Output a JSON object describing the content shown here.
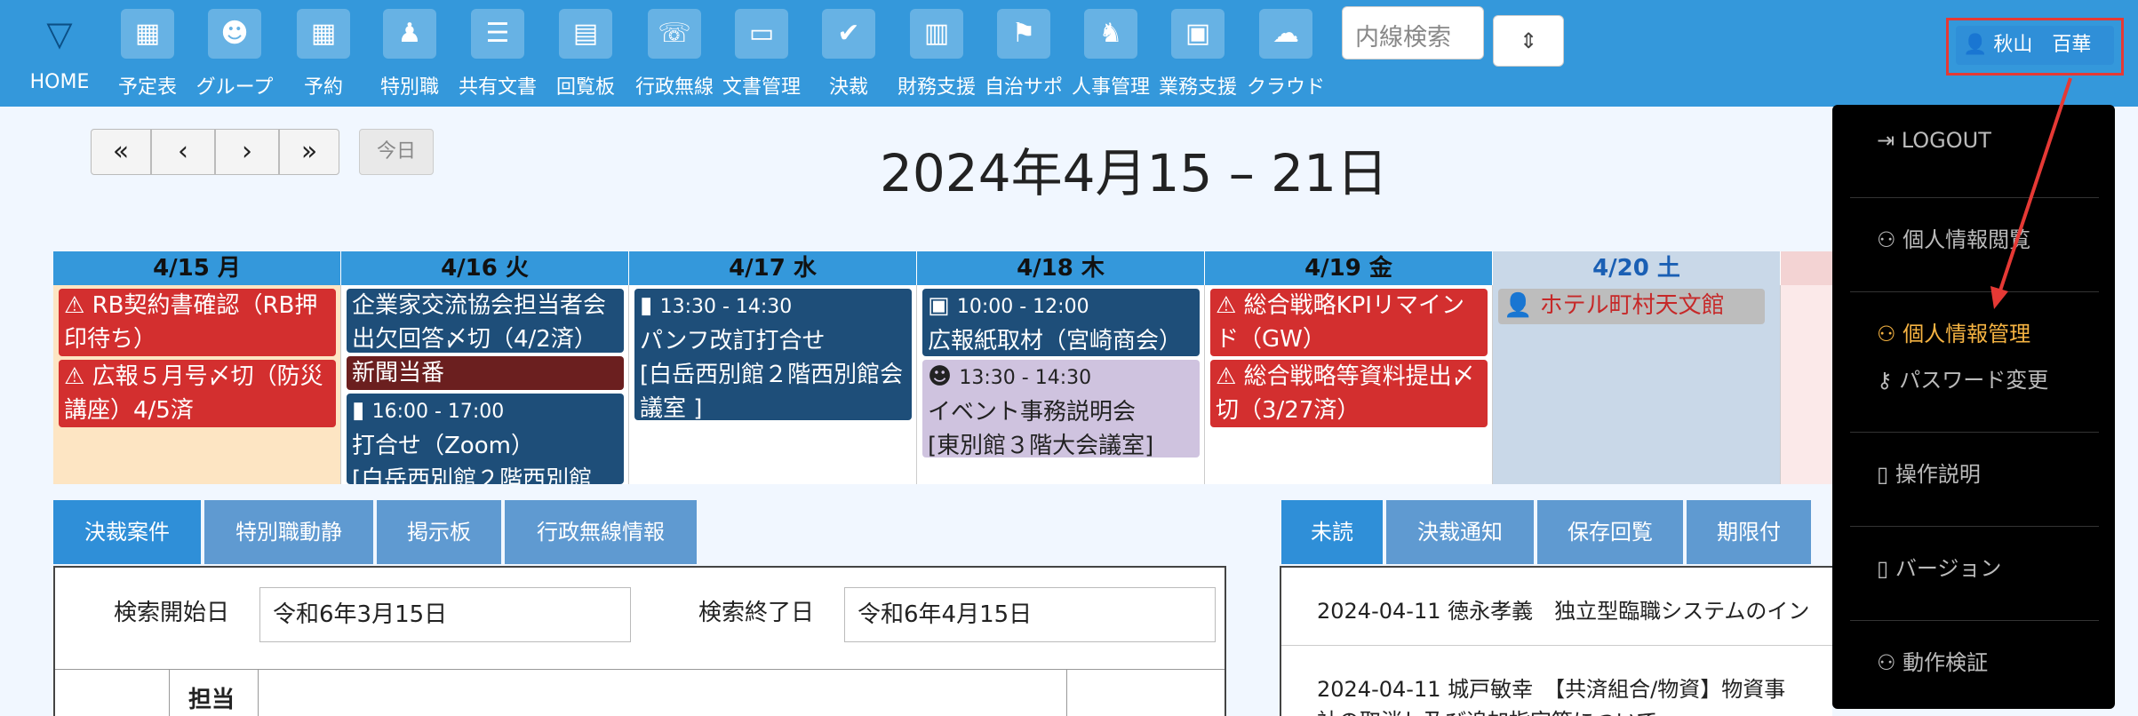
{
  "nav": [
    {
      "label": "HOME",
      "icon": "home-logo-icon"
    },
    {
      "label": "予定表",
      "icon": "calendar-icon"
    },
    {
      "label": "グループ",
      "icon": "group-icon"
    },
    {
      "label": "予約",
      "icon": "reservation-icon"
    },
    {
      "label": "特別職",
      "icon": "special-staff-icon"
    },
    {
      "label": "共有文書",
      "icon": "shared-docs-icon"
    },
    {
      "label": "回覧板",
      "icon": "clipboard-icon"
    },
    {
      "label": "行政無線",
      "icon": "radio-icon"
    },
    {
      "label": "文書管理",
      "icon": "document-icon"
    },
    {
      "label": "決裁",
      "icon": "approval-check-icon"
    },
    {
      "label": "財務支援",
      "icon": "finance-icon"
    },
    {
      "label": "自治サポ",
      "icon": "support-icon"
    },
    {
      "label": "人事管理",
      "icon": "hr-icon"
    },
    {
      "label": "業務支援",
      "icon": "business-icon"
    },
    {
      "label": "クラウド",
      "icon": "cloud-icon"
    }
  ],
  "search_placeholder": "内線検索",
  "user": {
    "name": "秋山　百華"
  },
  "calendar": {
    "title": "2024年4月15 – 21日",
    "today_label": "今日",
    "nav": [
      "«",
      "‹",
      "›",
      "»"
    ],
    "days": [
      {
        "label": "4/15 月"
      },
      {
        "label": "4/16 火"
      },
      {
        "label": "4/17 水"
      },
      {
        "label": "4/18 木"
      },
      {
        "label": "4/19 金"
      },
      {
        "label": "4/20 土"
      }
    ],
    "events": {
      "mon": [
        {
          "title": "RB契約書確認（RB押印待ち）"
        },
        {
          "title": "広報５月号〆切（防災講座）4/5済"
        }
      ],
      "tue": [
        {
          "title": "企業家交流協会担当者会出欠回答〆切（4/2済）"
        },
        {
          "title": "新聞当番"
        },
        {
          "time": "16:00 - 17:00",
          "title": "打合せ（Zoom）",
          "loc": "[白岳西別館２階西別館"
        }
      ],
      "wed": [
        {
          "time": "13:30 - 14:30",
          "title": "パンフ改訂打合せ",
          "loc": "[白岳西別館２階西別館会議室 ]"
        }
      ],
      "thu": [
        {
          "time": "10:00 - 12:00",
          "title": "広報紙取材（宮崎商会）"
        },
        {
          "time": "13:30 - 14:30",
          "title": "イベント事務説明会",
          "loc": "[東別館３階大会議室]"
        }
      ],
      "fri": [
        {
          "title": "総合戦略KPIリマインド（GW）"
        },
        {
          "title": "総合戦略等資料提出〆切（3/27済）"
        }
      ],
      "sat": [
        {
          "title": "ホテル町村天文館"
        }
      ]
    }
  },
  "left_tabs": [
    "決裁案件",
    "特別職動静",
    "掲示板",
    "行政無線情報"
  ],
  "search": {
    "start_label": "検索開始日",
    "start_value": "令和6年3月15日",
    "end_label": "検索終了日",
    "end_value": "令和6年4月15日"
  },
  "table_header": "担当",
  "right_tabs": [
    "未読",
    "決裁通知",
    "保存回覧",
    "期限付"
  ],
  "news": [
    {
      "text": "2024-04-11 徳永孝義　独立型臨職システムのイン"
    },
    {
      "text": "2024-04-11 城戸敏幸　【共済組合/物資】物資事"
    },
    {
      "text": "社の取消し及び追加指定等について"
    }
  ],
  "menu": [
    {
      "label": "LOGOUT",
      "icon": "logout-icon"
    },
    {
      "label": "個人情報閲覧",
      "icon": "user-view-icon"
    },
    {
      "label": "個人情報管理",
      "icon": "user-edit-icon"
    },
    {
      "label": "パスワード変更",
      "icon": "key-icon"
    },
    {
      "label": "操作説明",
      "icon": "file-icon"
    },
    {
      "label": "バージョン",
      "icon": "file-icon"
    },
    {
      "label": "動作検証",
      "icon": "user-check-icon"
    }
  ],
  "colors": {
    "header": "#3498db",
    "accent": "#2f8fd8",
    "highlight": "#e53935",
    "menu_active": "#f5b342"
  }
}
